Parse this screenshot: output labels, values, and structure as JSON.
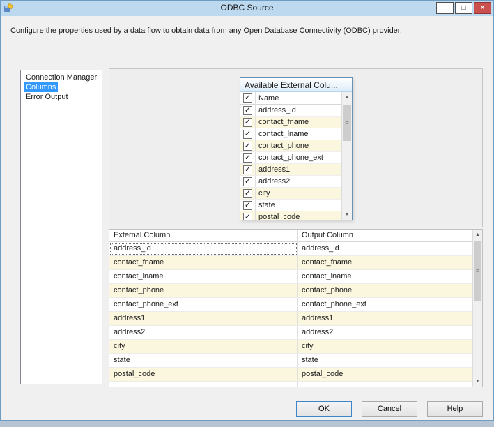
{
  "window": {
    "title": "ODBC Source",
    "controls": {
      "minimize": "—",
      "maximize": "□",
      "close": "×"
    }
  },
  "description": "Configure the properties used by a data flow to obtain data from any Open Database Connectivity (ODBC) provider.",
  "sidebar": {
    "items": [
      {
        "label": "Connection Manager",
        "selected": false
      },
      {
        "label": "Columns",
        "selected": true
      },
      {
        "label": "Error Output",
        "selected": false
      }
    ]
  },
  "available_columns": {
    "title": "Available External Colu...",
    "name_header": "Name",
    "header_checked": true,
    "rows": [
      {
        "label": "address_id",
        "checked": true
      },
      {
        "label": "contact_fname",
        "checked": true
      },
      {
        "label": "contact_lname",
        "checked": true
      },
      {
        "label": "contact_phone",
        "checked": true
      },
      {
        "label": "contact_phone_ext",
        "checked": true
      },
      {
        "label": "address1",
        "checked": true
      },
      {
        "label": "address2",
        "checked": true
      },
      {
        "label": "city",
        "checked": true
      },
      {
        "label": "state",
        "checked": true
      },
      {
        "label": "postal_code",
        "checked": true
      }
    ]
  },
  "mapping_table": {
    "columns": [
      "External Column",
      "Output Column"
    ],
    "rows": [
      [
        "address_id",
        "address_id"
      ],
      [
        "contact_fname",
        "contact_fname"
      ],
      [
        "contact_lname",
        "contact_lname"
      ],
      [
        "contact_phone",
        "contact_phone"
      ],
      [
        "contact_phone_ext",
        "contact_phone_ext"
      ],
      [
        "address1",
        "address1"
      ],
      [
        "address2",
        "address2"
      ],
      [
        "city",
        "city"
      ],
      [
        "state",
        "state"
      ],
      [
        "postal_code",
        "postal_code"
      ]
    ]
  },
  "buttons": {
    "ok": "OK",
    "cancel": "Cancel",
    "help_accel": "H",
    "help_rest": "elp"
  },
  "colors": {
    "titlebar": "#bdd9ef",
    "selection": "#3399ff",
    "row_alt": "#fbf6de",
    "check": "✓"
  }
}
